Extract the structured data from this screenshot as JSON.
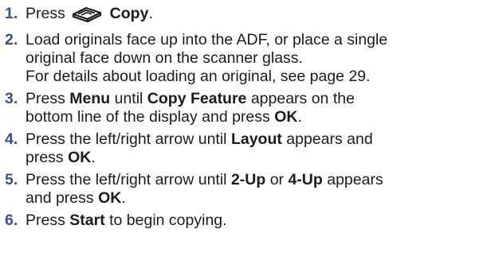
{
  "steps": [
    {
      "num": "1.",
      "lines": [
        [
          {
            "t": "Press "
          },
          {
            "icon": "copy-button-icon"
          },
          {
            "t": " Copy",
            "b": true
          },
          {
            "t": "."
          }
        ]
      ]
    },
    {
      "num": "2.",
      "lines": [
        [
          {
            "t": "Load originals face up into the ADF, or place a single"
          }
        ],
        [
          {
            "t": "original face down on the scanner glass."
          }
        ],
        [
          {
            "t": "For details about loading an original, see page 29."
          }
        ]
      ]
    },
    {
      "num": "3.",
      "lines": [
        [
          {
            "t": "Press "
          },
          {
            "t": "Menu",
            "b": true
          },
          {
            "t": " until "
          },
          {
            "t": "Copy Feature",
            "b": true
          },
          {
            "t": " appears on the"
          }
        ],
        [
          {
            "t": "bottom line of the display and press "
          },
          {
            "t": "OK",
            "b": true
          },
          {
            "t": "."
          }
        ]
      ]
    },
    {
      "num": "4.",
      "lines": [
        [
          {
            "t": "Press the left/right arrow until "
          },
          {
            "t": "Layout",
            "b": true
          },
          {
            "t": " appears and"
          }
        ],
        [
          {
            "t": "press "
          },
          {
            "t": "OK",
            "b": true
          },
          {
            "t": "."
          }
        ]
      ]
    },
    {
      "num": "5.",
      "lines": [
        [
          {
            "t": "Press the left/right arrow until "
          },
          {
            "t": "2-Up",
            "b": true
          },
          {
            "t": " or "
          },
          {
            "t": "4-Up",
            "b": true
          },
          {
            "t": " appears"
          }
        ],
        [
          {
            "t": "and press "
          },
          {
            "t": "OK",
            "b": true
          },
          {
            "t": "."
          }
        ]
      ]
    },
    {
      "num": "6.",
      "lines": [
        [
          {
            "t": "Press "
          },
          {
            "t": "Start",
            "b": true
          },
          {
            "t": " to begin copying."
          }
        ]
      ]
    }
  ],
  "colors": {
    "step_number": "#3b4e8e",
    "text": "#1c1c1c"
  }
}
